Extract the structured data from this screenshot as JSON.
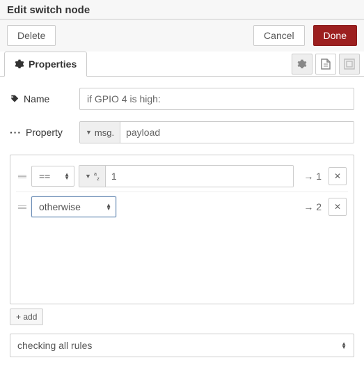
{
  "header": {
    "title": "Edit switch node"
  },
  "actions": {
    "delete_label": "Delete",
    "cancel_label": "Cancel",
    "done_label": "Done"
  },
  "tabs": {
    "properties_label": "Properties"
  },
  "form": {
    "name_label": "Name",
    "name_value": "if GPIO 4 is high:",
    "property_label": "Property",
    "property_type_prefix": "msg.",
    "property_value": "payload"
  },
  "rules": [
    {
      "operator": "==",
      "value_type_prefix": "",
      "value": "1",
      "output": "1"
    },
    {
      "operator": "otherwise",
      "value_type_prefix": "",
      "value": "",
      "output": "2"
    }
  ],
  "rules_footer": {
    "add_label": "+ add"
  },
  "mode": {
    "selected_label": "checking all rules"
  }
}
